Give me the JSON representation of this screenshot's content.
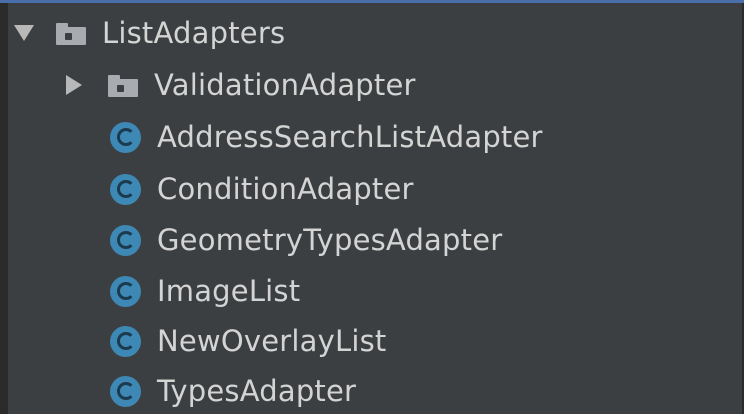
{
  "tree": {
    "root": {
      "label": "ListAdapters",
      "expanded": true,
      "icon": "folder-icon"
    },
    "children": [
      {
        "label": "ValidationAdapter",
        "type": "package",
        "expanded": false,
        "icon": "folder-icon"
      },
      {
        "label": "AddressSearchListAdapter",
        "type": "class",
        "icon": "class-icon"
      },
      {
        "label": "ConditionAdapter",
        "type": "class",
        "icon": "class-icon"
      },
      {
        "label": "GeometryTypesAdapter",
        "type": "class",
        "icon": "class-icon"
      },
      {
        "label": "ImageList",
        "type": "class",
        "icon": "class-icon"
      },
      {
        "label": "NewOverlayList",
        "type": "class",
        "icon": "class-icon"
      },
      {
        "label": "TypesAdapter",
        "type": "class",
        "icon": "class-icon"
      }
    ]
  },
  "colors": {
    "background": "#3c3f41",
    "text": "#d4d4d4",
    "class_icon": "#3d88b5",
    "folder_icon": "#a8acb0",
    "top_border": "#4a6ea9"
  }
}
